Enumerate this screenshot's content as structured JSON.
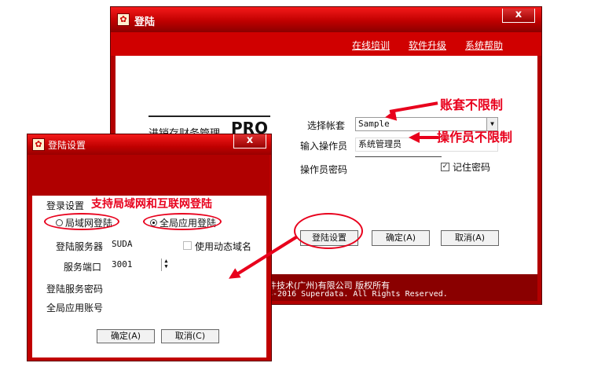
{
  "login_window": {
    "title": "登陆",
    "close_label": "x",
    "menu": [
      {
        "label": "在线培训"
      },
      {
        "label": "软件升级"
      },
      {
        "label": "系统帮助"
      }
    ],
    "brand": {
      "text": "进销存财务管理",
      "pro": "PRO"
    },
    "account": {
      "label": "选择帐套",
      "value": "Sample"
    },
    "operator": {
      "label": "输入操作员",
      "value": "系统管理员"
    },
    "password": {
      "label": "操作员密码",
      "value": ""
    },
    "remember": {
      "label": "记住密码",
      "checked": true
    },
    "buttons": {
      "settings": "登陆设置",
      "ok": "确定(A)",
      "cancel": "取消(A)"
    },
    "footer": {
      "line1": "件技术(广州)有限公司  版权所有",
      "line2": "3-2016 Superdata. All Rights Reserved."
    }
  },
  "settings_window": {
    "title": "登陆设置",
    "close_label": "x",
    "section_label": "登录设置",
    "radio_lan": {
      "label": "局域网登陆",
      "selected": false
    },
    "radio_global": {
      "label": "全局应用登陆",
      "selected": true
    },
    "server": {
      "label": "登陆服务器",
      "value": "SUDA"
    },
    "dynamic_domain": {
      "label": "使用动态域名",
      "checked": false
    },
    "port": {
      "label": "服务端口",
      "value": "3001"
    },
    "server_password": {
      "label": "登陆服务密码",
      "value": ""
    },
    "global_account": {
      "label": "全局应用账号",
      "value": ""
    },
    "buttons": {
      "ok": "确定(A)",
      "cancel": "取消(C)"
    }
  },
  "annotations": {
    "account_note": "账套不限制",
    "operator_note": "操作员不限制",
    "network_note": "支持局域网和互联网登陆"
  },
  "colors": {
    "window_red": "#c00000",
    "annotation_red": "#e8001c"
  }
}
